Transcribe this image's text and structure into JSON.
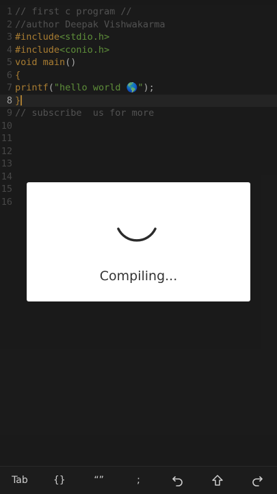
{
  "editor": {
    "lines": [
      {
        "num": "1",
        "parts": [
          {
            "t": "// first c program //",
            "c": "comment"
          }
        ]
      },
      {
        "num": "2",
        "parts": [
          {
            "t": "//author Deepak Vishwakarma",
            "c": "comment"
          }
        ]
      },
      {
        "num": "3",
        "parts": [
          {
            "t": "#include",
            "c": "kw"
          },
          {
            "t": "<stdio.h>",
            "c": "str"
          }
        ]
      },
      {
        "num": "4",
        "parts": [
          {
            "t": "#include",
            "c": "kw"
          },
          {
            "t": "<conio.h>",
            "c": "str"
          }
        ]
      },
      {
        "num": "5",
        "parts": [
          {
            "t": "void main",
            "c": "kw"
          },
          {
            "t": "()",
            "c": "plain"
          }
        ]
      },
      {
        "num": "6",
        "parts": [
          {
            "t": "{",
            "c": "kw"
          }
        ]
      },
      {
        "num": "7",
        "parts": [
          {
            "t": "printf",
            "c": "kw"
          },
          {
            "t": "(",
            "c": "plain"
          },
          {
            "t": "\"hello world 🌎\"",
            "c": "str"
          },
          {
            "t": ");",
            "c": "plain"
          }
        ]
      },
      {
        "num": "8",
        "parts": [
          {
            "t": "}",
            "c": "kw"
          }
        ],
        "current": true
      },
      {
        "num": "9",
        "parts": [
          {
            "t": "// subscribe  us for more",
            "c": "comment"
          }
        ]
      },
      {
        "num": "10",
        "parts": []
      },
      {
        "num": "11",
        "parts": []
      },
      {
        "num": "12",
        "parts": []
      },
      {
        "num": "13",
        "parts": []
      },
      {
        "num": "14",
        "parts": []
      },
      {
        "num": "15",
        "parts": []
      },
      {
        "num": "16",
        "parts": []
      }
    ]
  },
  "dialog": {
    "message": "Compiling..."
  },
  "keybar": {
    "tab": "Tab",
    "braces": "{}",
    "quotes": "“”",
    "semicolon": ";",
    "undo_icon": "undo-icon",
    "shift_icon": "shift-up-icon",
    "redo_icon": "redo-icon"
  },
  "colors": {
    "background": "#222222",
    "keyword": "#d9a040",
    "string": "#79b64a",
    "comment": "#6a6a6a",
    "line_number": "#5b5b5b"
  }
}
